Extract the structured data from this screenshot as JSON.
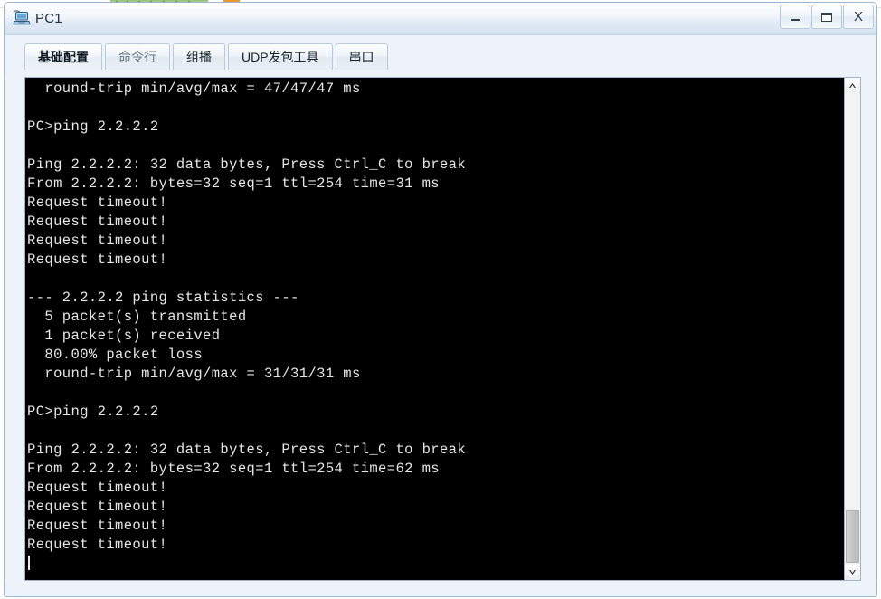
{
  "window": {
    "title": "PC1",
    "icon": "computer-icon",
    "controls": {
      "minimize_label": "–",
      "maximize_label": "□",
      "close_label": "X"
    }
  },
  "tabs": [
    {
      "label": "基础配置",
      "selected": true
    },
    {
      "label": "命令行",
      "selected": false
    },
    {
      "label": "组播",
      "selected": false
    },
    {
      "label": "UDP发包工具",
      "selected": false
    },
    {
      "label": "串口",
      "selected": false
    }
  ],
  "console": {
    "prompt": "PC>",
    "lines": [
      "  round-trip min/avg/max = 47/47/47 ms",
      "",
      "PC>ping 2.2.2.2",
      "",
      "Ping 2.2.2.2: 32 data bytes, Press Ctrl_C to break",
      "From 2.2.2.2: bytes=32 seq=1 ttl=254 time=31 ms",
      "Request timeout!",
      "Request timeout!",
      "Request timeout!",
      "Request timeout!",
      "",
      "--- 2.2.2.2 ping statistics ---",
      "  5 packet(s) transmitted",
      "  1 packet(s) received",
      "  80.00% packet loss",
      "  round-trip min/avg/max = 31/31/31 ms",
      "",
      "PC>ping 2.2.2.2",
      "",
      "Ping 2.2.2.2: 32 data bytes, Press Ctrl_C to break",
      "From 2.2.2.2: bytes=32 seq=1 ttl=254 time=62 ms",
      "Request timeout!",
      "Request timeout!",
      "Request timeout!",
      "Request timeout!"
    ],
    "caret_visible": true,
    "text_color": "#e6e6e6",
    "background_color": "#000000"
  },
  "scrollbar": {
    "up_arrow": "chevron-up",
    "down_arrow": "chevron-down",
    "thumb_position": "bottom"
  }
}
